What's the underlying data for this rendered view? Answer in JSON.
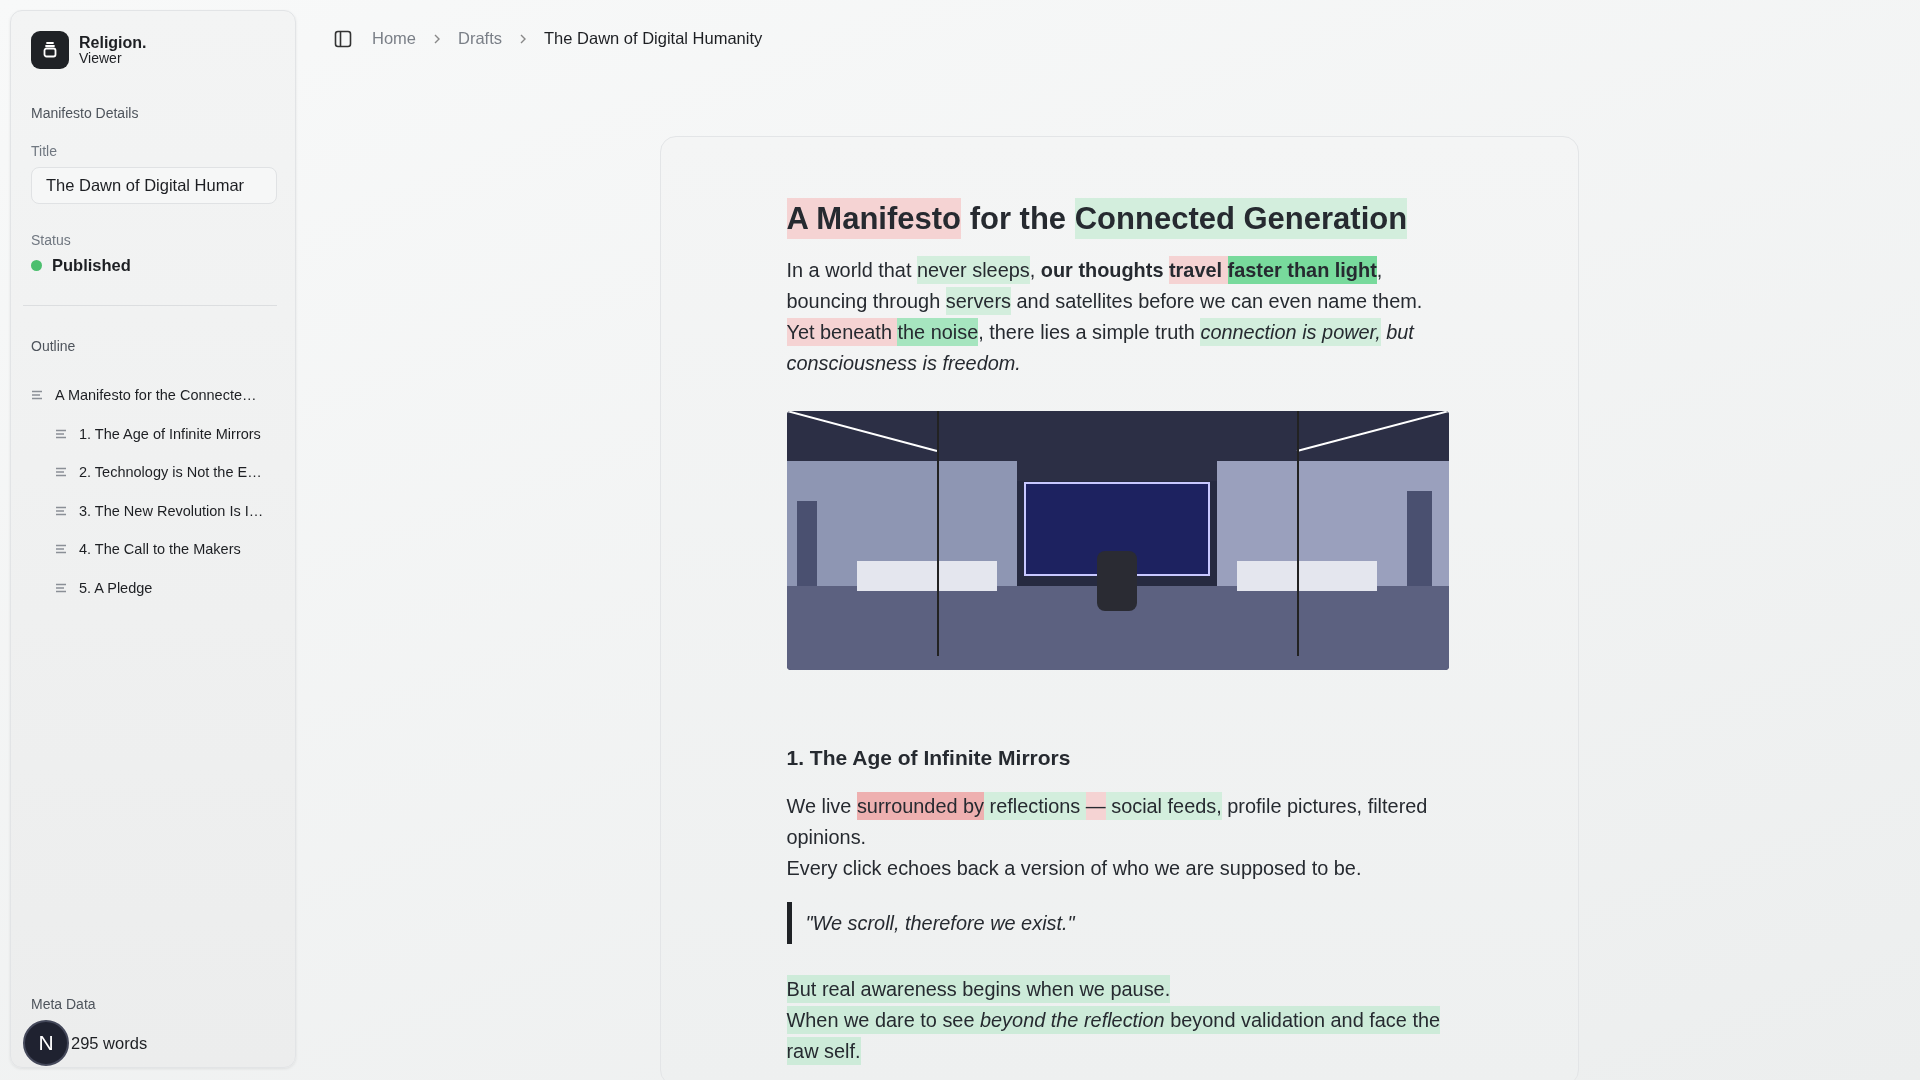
{
  "sidebar": {
    "brand": {
      "name": "Religion.",
      "role": "Viewer"
    },
    "details_heading": "Manifesto Details",
    "title_label": "Title",
    "title_value": "The Dawn of Digital Humar",
    "status_label": "Status",
    "status": {
      "text": "Published",
      "color": "#4cbf6e"
    },
    "outline_heading": "Outline",
    "outline": [
      {
        "label": "A Manifesto for the Connecte…",
        "children": [
          {
            "label": "1. The Age of Infinite Mirrors"
          },
          {
            "label": "2. Technology is Not the E…"
          },
          {
            "label": "3. The New Revolution Is I…"
          },
          {
            "label": "4. The Call to the Makers"
          },
          {
            "label": "5. A Pledge"
          }
        ]
      }
    ],
    "meta_heading": "Meta Data",
    "word_count": "295 words"
  },
  "floating_badge": "N",
  "breadcrumb": [
    {
      "label": "Home",
      "current": false
    },
    {
      "label": "Drafts",
      "current": false
    },
    {
      "label": "The Dawn of Digital Humanity",
      "current": true
    }
  ],
  "document": [
    {
      "kind": "title",
      "lines": [
        [
          {
            "text": "A Manifesto",
            "color": "#f5d3d3"
          },
          {
            "text": " for the "
          },
          {
            "text": "Connected Generation",
            "color": "#d3eedd"
          }
        ]
      ]
    },
    {
      "kind": "paragraph",
      "lines": [
        [
          {
            "text": "In a world that "
          },
          {
            "text": "never sleeps",
            "color": "#d3eedd"
          },
          {
            "text": ", **our thoughts** "
          },
          {
            "text": "**travel** ",
            "color": "#f5d3d3"
          },
          {
            "text": "**faster than light**",
            "color": "#78da9c"
          },
          {
            "text": ", bouncing through "
          },
          {
            "text": "servers",
            "color": "#d3eedd"
          },
          {
            "text": " and satellites before we can even name them. "
          },
          {
            "text": "Yet beneath ",
            "color": "#f5d3d3"
          },
          {
            "text": "the noise",
            "color": "#a6e5bf"
          },
          {
            "text": ", there lies a simple truth "
          },
          {
            "text": "*connection is power,*",
            "color": "#d3eedd"
          },
          {
            "text": " *but consciousness is freedom.*"
          }
        ]
      ]
    },
    {
      "kind": "picture"
    },
    {
      "kind": "heading",
      "lines": [
        [
          {
            "text": "1. The Age of Infinite Mirrors"
          }
        ]
      ]
    },
    {
      "kind": "paragraph",
      "lines": [
        [
          {
            "text": "We live "
          },
          {
            "text": "surrounded by",
            "color": "#eeb0b0"
          },
          {
            "text": " reflections ",
            "color": "#d3eedd"
          },
          {
            "text": "—",
            "color": "#f5d3d3"
          },
          {
            "text": " social feeds,",
            "color": "#d3eedd"
          },
          {
            "text": " profile pictures, filtered opinions."
          }
        ],
        [
          {
            "text": "Every click echoes back a version of who we are supposed to be."
          }
        ]
      ]
    },
    {
      "kind": "quote",
      "lines": [
        [
          {
            "text": "\"We scroll, therefore we exist.\""
          }
        ]
      ]
    },
    {
      "kind": "paragraph",
      "lines": [
        [
          {
            "text": "But real awareness begins when we pause.",
            "color": "#cdebd9"
          }
        ],
        [
          {
            "text": "When we dare to see *beyond the reflection* beyond validation and face the raw self.",
            "color": "#cdebd9"
          }
        ]
      ]
    }
  ]
}
